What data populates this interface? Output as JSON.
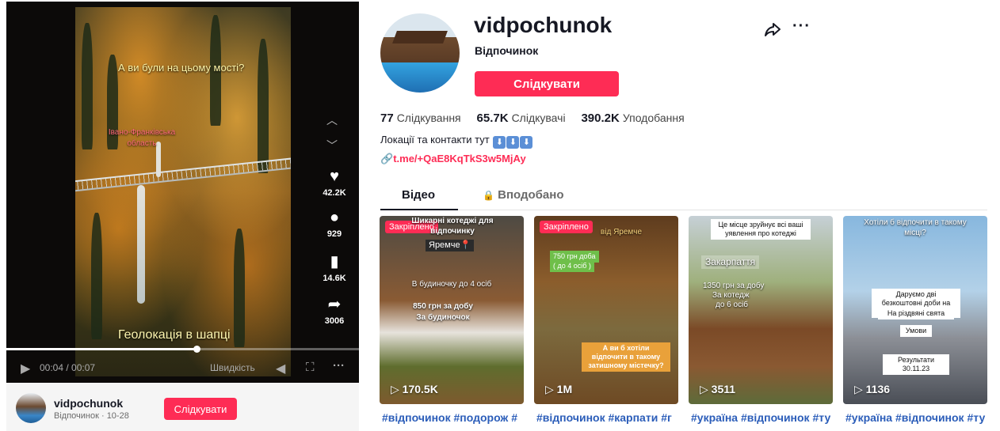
{
  "player": {
    "overlay_question": "А ви були на цьому мості?",
    "overlay_region": "Івано-Франківська область",
    "overlay_geo": "Геолокація в шапці",
    "likes": "42.2K",
    "comments": "929",
    "saves": "14.6K",
    "shares": "3006",
    "time": "00:04 / 00:07",
    "speed_label": "Швидкість",
    "progress": 0.54
  },
  "author_bar": {
    "name": "vidpochunok",
    "sub": "Відпочинок · 10-28",
    "follow_label": "Слідкувати"
  },
  "profile": {
    "username": "vidpochunok",
    "nickname": "Відпочинок",
    "follow_label": "Слідкувати",
    "following_count": "77",
    "following_label": "Слідкування",
    "followers_count": "65.7K",
    "followers_label": "Слідкувачі",
    "likes_count": "390.2K",
    "likes_label": "Уподобання",
    "bio": "Локації та контакти тут",
    "bio_keys": [
      "⬇",
      "⬇",
      "⬇"
    ],
    "link": "t.me/+QaE8KqTkS3w5MjAy"
  },
  "tabs": [
    {
      "label": "Відео",
      "active": true
    },
    {
      "label": "Вподобано",
      "active": false,
      "icon": "lock-icon"
    }
  ],
  "videos": [
    {
      "pinned_label": "Закріплено",
      "views": "170.5K",
      "caption": "#відпочинок #подорож #",
      "texts": [
        "Шикарні котеджі для відпочинку",
        "Яремче📍",
        "В будиночку до 4 осіб",
        "850 грн за добу",
        "За будиночок"
      ]
    },
    {
      "pinned_label": "Закріплено",
      "views": "1M",
      "caption": "#відпочинок #карпати #г",
      "texts": [
        "від Яремче",
        "750 грн доба",
        "( до 4 осіб )",
        "А ви б хотіли відпочити в такому затишному містечку?"
      ]
    },
    {
      "views": "3511",
      "caption": "#україна #відпочинок #ту",
      "texts": [
        "Це місце зруйнує всі ваші уявлення про котеджі",
        "Закарпаття",
        "1350 грн за добу",
        "За котедж",
        "до 6 осіб"
      ]
    },
    {
      "views": "1136",
      "caption": "#україна #відпочинок #ту",
      "texts": [
        "Хотіли б відпочити в такому місці?",
        "Даруємо дві безкоштовні доби на двох",
        "На різдвяні свята",
        "Умови",
        "Результати 30.11.23"
      ]
    }
  ]
}
